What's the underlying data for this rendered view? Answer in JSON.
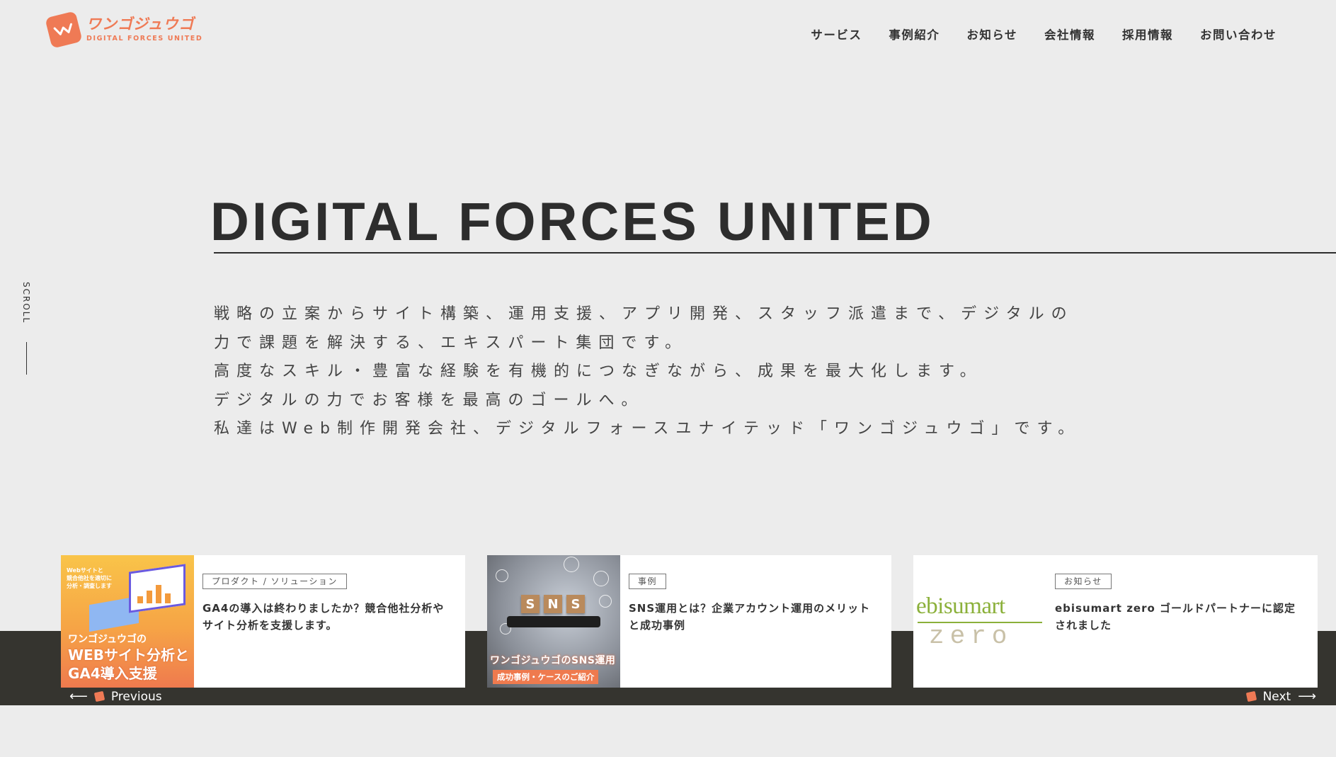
{
  "brand": {
    "logo_jp": "ワンゴジュウゴ",
    "logo_en": "DIGITAL FORCES UNITED",
    "accent_color": "#ef7a55"
  },
  "nav": {
    "items": [
      "サービス",
      "事例紹介",
      "お知らせ",
      "会社情報",
      "採用情報",
      "お問い合わせ"
    ]
  },
  "scroll": {
    "label": "SCROLL"
  },
  "hero": {
    "title": "DIGITAL FORCES UNITED",
    "lines": [
      "戦略の立案からサイト構築、運用支援、アプリ開発、スタッフ派遣まで、デジタルの",
      "力で課題を解決する、エキスパート集団です。",
      "高度なスキル・豊富な経験を有機的につなぎながら、成果を最大化します。",
      "デジタルの力でお客様を最高のゴールへ。",
      "私達はWeb制作開発会社、デジタルフォースユナイテッド「ワンゴジュウゴ」です。"
    ]
  },
  "cards": [
    {
      "tag": "プロダクト / ソリューション",
      "title": "GA4の導入は終わりましたか？競合他社分析やサイト分析を支援します。",
      "thumb": {
        "small_text": [
          "Webサイトと",
          "競合他社を適切に",
          "分析・調査します"
        ],
        "brand": "ワンゴジュウゴの",
        "lines": [
          "WEBサイト分析と",
          "GA4導入支援"
        ]
      }
    },
    {
      "tag": "事例",
      "title": "SNS運用とは？企業アカウント運用のメリットと成功事例",
      "thumb": {
        "blocks": [
          "S",
          "N",
          "S"
        ],
        "caption": "ワンゴジュウゴのSNS運用",
        "subcaption": "成功事例・ケースのご紹介"
      }
    },
    {
      "tag": "お知らせ",
      "title": "ebisumart zero ゴールドパートナーに認定されました",
      "thumb": {
        "main": "ebisumart",
        "sub": "zero"
      }
    }
  ],
  "controls": {
    "prev": "Previous",
    "next": "Next"
  }
}
